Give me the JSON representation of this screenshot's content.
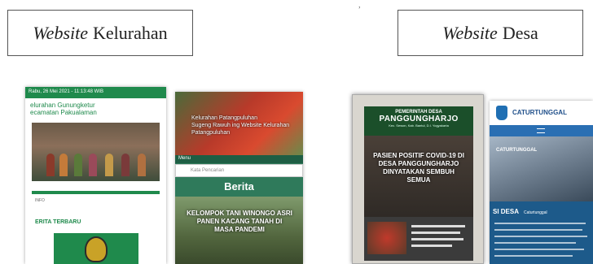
{
  "labels": {
    "kelurahan": {
      "italic": "Website",
      "text": "Kelurahan"
    },
    "desa": {
      "italic": "Website",
      "text": "Desa"
    }
  },
  "kelurahan_site_1": {
    "date_bar": "Rabu, 26 Mei 2021 - 11:13:48 WIB",
    "title_line1": "elurahan Gunungketur",
    "title_line2": "ecamatan Pakualaman",
    "caption": "INFO",
    "section": "ERITA TERBARU"
  },
  "kelurahan_site_2": {
    "banner_title": "Kelurahan Patangpuluhan",
    "banner_sub": "Sugeng Rawuh ing Website Kelurahan Patangpuluhan",
    "menu": "Menu",
    "search_placeholder": "Kata Pencarian",
    "berita": "Berita",
    "photo_title": "KELOMPOK TANI WINONGO ASRI PANEN KACANG TANAH DI MASA PANDEMI"
  },
  "desa_site_1": {
    "header_pre": "PEMERINTAH DESA",
    "header_name": "PANGGUNGHARJO",
    "header_sub": "Kec. Sewon, Kab. Bantul, D.I. Yogyakarta",
    "news_title": "PASIEN POSITIF COVID-19 DI DESA PANGGUNGHARJO DINYATAKAN SEMBUH SEMUA"
  },
  "desa_site_2": {
    "header_name": "CATURTUNGGAL",
    "photo_title": "CATURTUNGGAL",
    "section": "SI DESA",
    "tag": "Caturtunggal"
  }
}
